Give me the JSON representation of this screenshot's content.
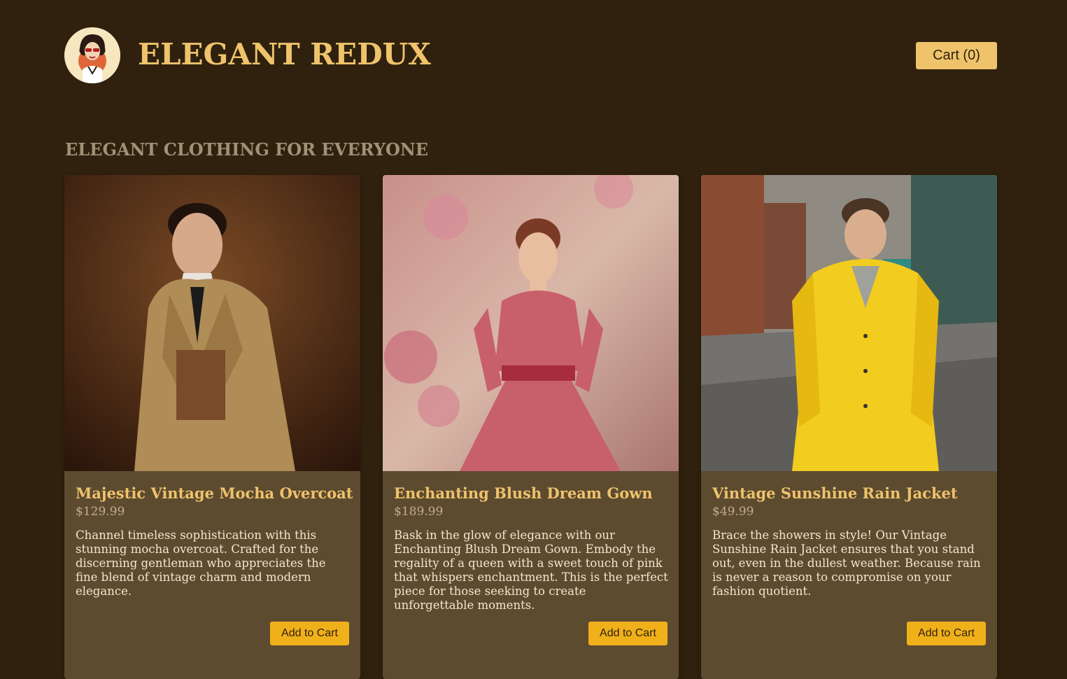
{
  "header": {
    "brand": "ELEGANT REDUX",
    "cart_label": "Cart (0)"
  },
  "hero": {
    "tagline": "ELEGANT CLOTHING FOR EVERYONE"
  },
  "products": [
    {
      "title": "Majestic Vintage Mocha Overcoat",
      "price": "$129.99",
      "description": "Channel timeless sophistication with this stunning mocha overcoat. Crafted for the discerning gentleman who appreciates the fine blend of vintage charm and modern elegance.",
      "button": "Add to Cart"
    },
    {
      "title": "Enchanting Blush Dream Gown",
      "price": "$189.99",
      "description": "Bask in the glow of elegance with our Enchanting Blush Dream Gown. Embody the regality of a queen with a sweet touch of pink that whispers enchantment. This is the perfect piece for those seeking to create unforgettable moments.",
      "button": "Add to Cart"
    },
    {
      "title": "Vintage Sunshine Rain Jacket",
      "price": "$49.99",
      "description": "Brace the showers in style! Our Vintage Sunshine Rain Jacket ensures that you stand out, even in the dullest weather. Because rain is never a reason to compromise on your fashion quotient.",
      "button": "Add to Cart"
    }
  ],
  "colors": {
    "background": "#2f210d",
    "accent": "#efc36c",
    "card": "#5d4b30",
    "button": "#f0b01a"
  }
}
